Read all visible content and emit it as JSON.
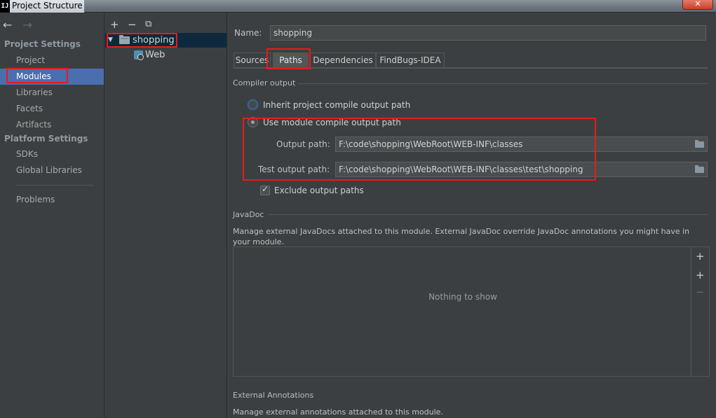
{
  "window": {
    "app_icon": "intellij-icon",
    "app_icon_text": "IJ",
    "title": "Project Structure",
    "close_label": "✕"
  },
  "nav": {
    "back_icon": "←",
    "forward_icon": "→",
    "project_settings_header": "Project Settings",
    "project_items": [
      "Project",
      "Modules",
      "Libraries",
      "Facets",
      "Artifacts"
    ],
    "platform_settings_header": "Platform Settings",
    "platform_items": [
      "SDKs",
      "Global Libraries"
    ],
    "problems": "Problems",
    "selected": "Modules"
  },
  "tree": {
    "toolbar": {
      "add": "+",
      "remove": "−",
      "copy": "⧉"
    },
    "expand_glyph": "▼",
    "root": "shopping",
    "child": "Web"
  },
  "main": {
    "name_label": "Name:",
    "name_value": "shopping",
    "tabs": [
      "Sources",
      "Paths",
      "Dependencies",
      "FindBugs-IDEA"
    ],
    "active_tab": "Paths",
    "compiler_output_header": "Compiler output",
    "inherit_option": "Inherit project compile output path",
    "module_option": "Use module compile output path",
    "output_path_label": "Output path:",
    "output_path_value": "F:\\code\\shopping\\WebRoot\\WEB-INF\\classes",
    "test_output_path_label": "Test output path:",
    "test_output_path_value": "F:\\code\\shopping\\WebRoot\\WEB-INF\\classes\\test\\shopping",
    "exclude_label": "Exclude output paths",
    "exclude_checked": true,
    "javadoc_header": "JavaDoc",
    "javadoc_desc": "Manage external JavaDocs attached to this module. External JavaDoc override JavaDoc annotations you might have in your module.",
    "javadoc_empty": "Nothing to show",
    "javadoc_tools": {
      "add": "+",
      "add_url": "+",
      "remove": "−"
    },
    "ext_annotations_header": "External Annotations",
    "ext_annotations_desc": "Manage external annotations attached to this module."
  },
  "colors": {
    "background": "#3c3f41",
    "selection": "#4b6eaf",
    "tree_selection": "#0d293e",
    "highlight": "#e81b1b"
  }
}
